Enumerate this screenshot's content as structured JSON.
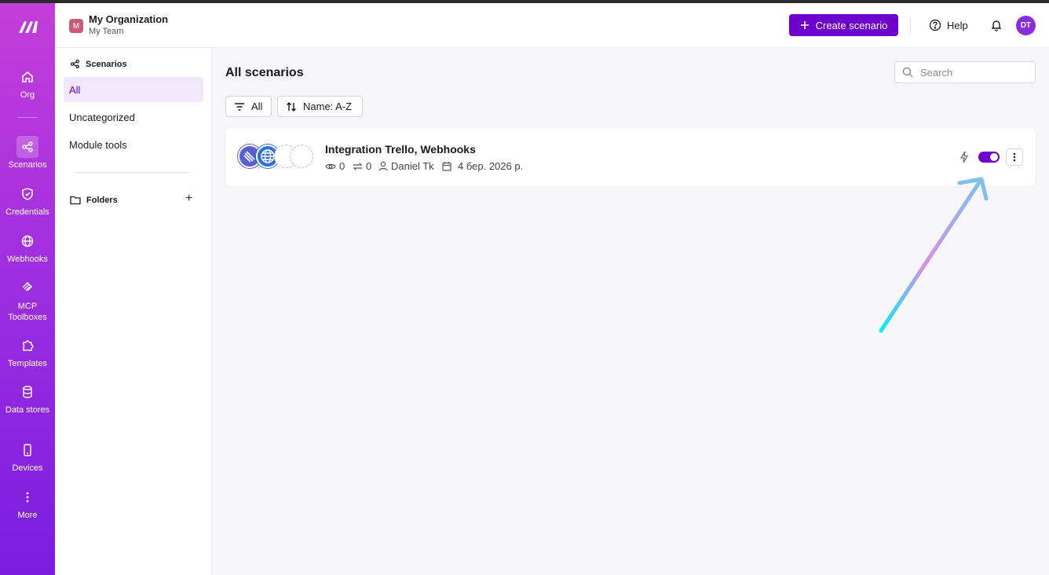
{
  "rail": {
    "items": [
      {
        "label": "Org",
        "icon": "home-icon"
      },
      {
        "label": "Scenarios",
        "icon": "share-nodes-icon"
      },
      {
        "label": "Credentials",
        "icon": "shield-check-icon"
      },
      {
        "label": "Webhooks",
        "icon": "globe-icon"
      },
      {
        "label": "MCP Toolboxes",
        "icon": "mcp-icon"
      },
      {
        "label": "Templates",
        "icon": "puzzle-icon"
      },
      {
        "label": "Data stores",
        "icon": "database-icon"
      },
      {
        "label": "Devices",
        "icon": "phone-icon"
      },
      {
        "label": "More",
        "icon": "more-vertical-icon"
      }
    ],
    "active": "Scenarios",
    "gradient": [
      "#c43ed9",
      "#7a1de0"
    ]
  },
  "header": {
    "org_initial": "M",
    "org_name": "My Organization",
    "team_name": "My Team",
    "create_label": "Create scenario",
    "help_label": "Help",
    "avatar_initials": "DT",
    "accent": "#6d00cc"
  },
  "sidebar": {
    "section_title": "Scenarios",
    "items": [
      {
        "label": "All",
        "active": true
      },
      {
        "label": "Uncategorized"
      },
      {
        "label": "Module tools"
      }
    ],
    "folders_title": "Folders",
    "add_label": "+"
  },
  "main": {
    "title": "All scenarios",
    "search_placeholder": "Search",
    "filter_label": "All",
    "sort_label": "Name: A-Z",
    "scenarios": [
      {
        "name": "Integration Trello, Webhooks",
        "views": "0",
        "operations": "0",
        "owner": "Daniel Tk",
        "date": "4 бер. 2026 р.",
        "active": true,
        "modules": [
          "trello-icon",
          "globe-icon"
        ]
      }
    ]
  }
}
